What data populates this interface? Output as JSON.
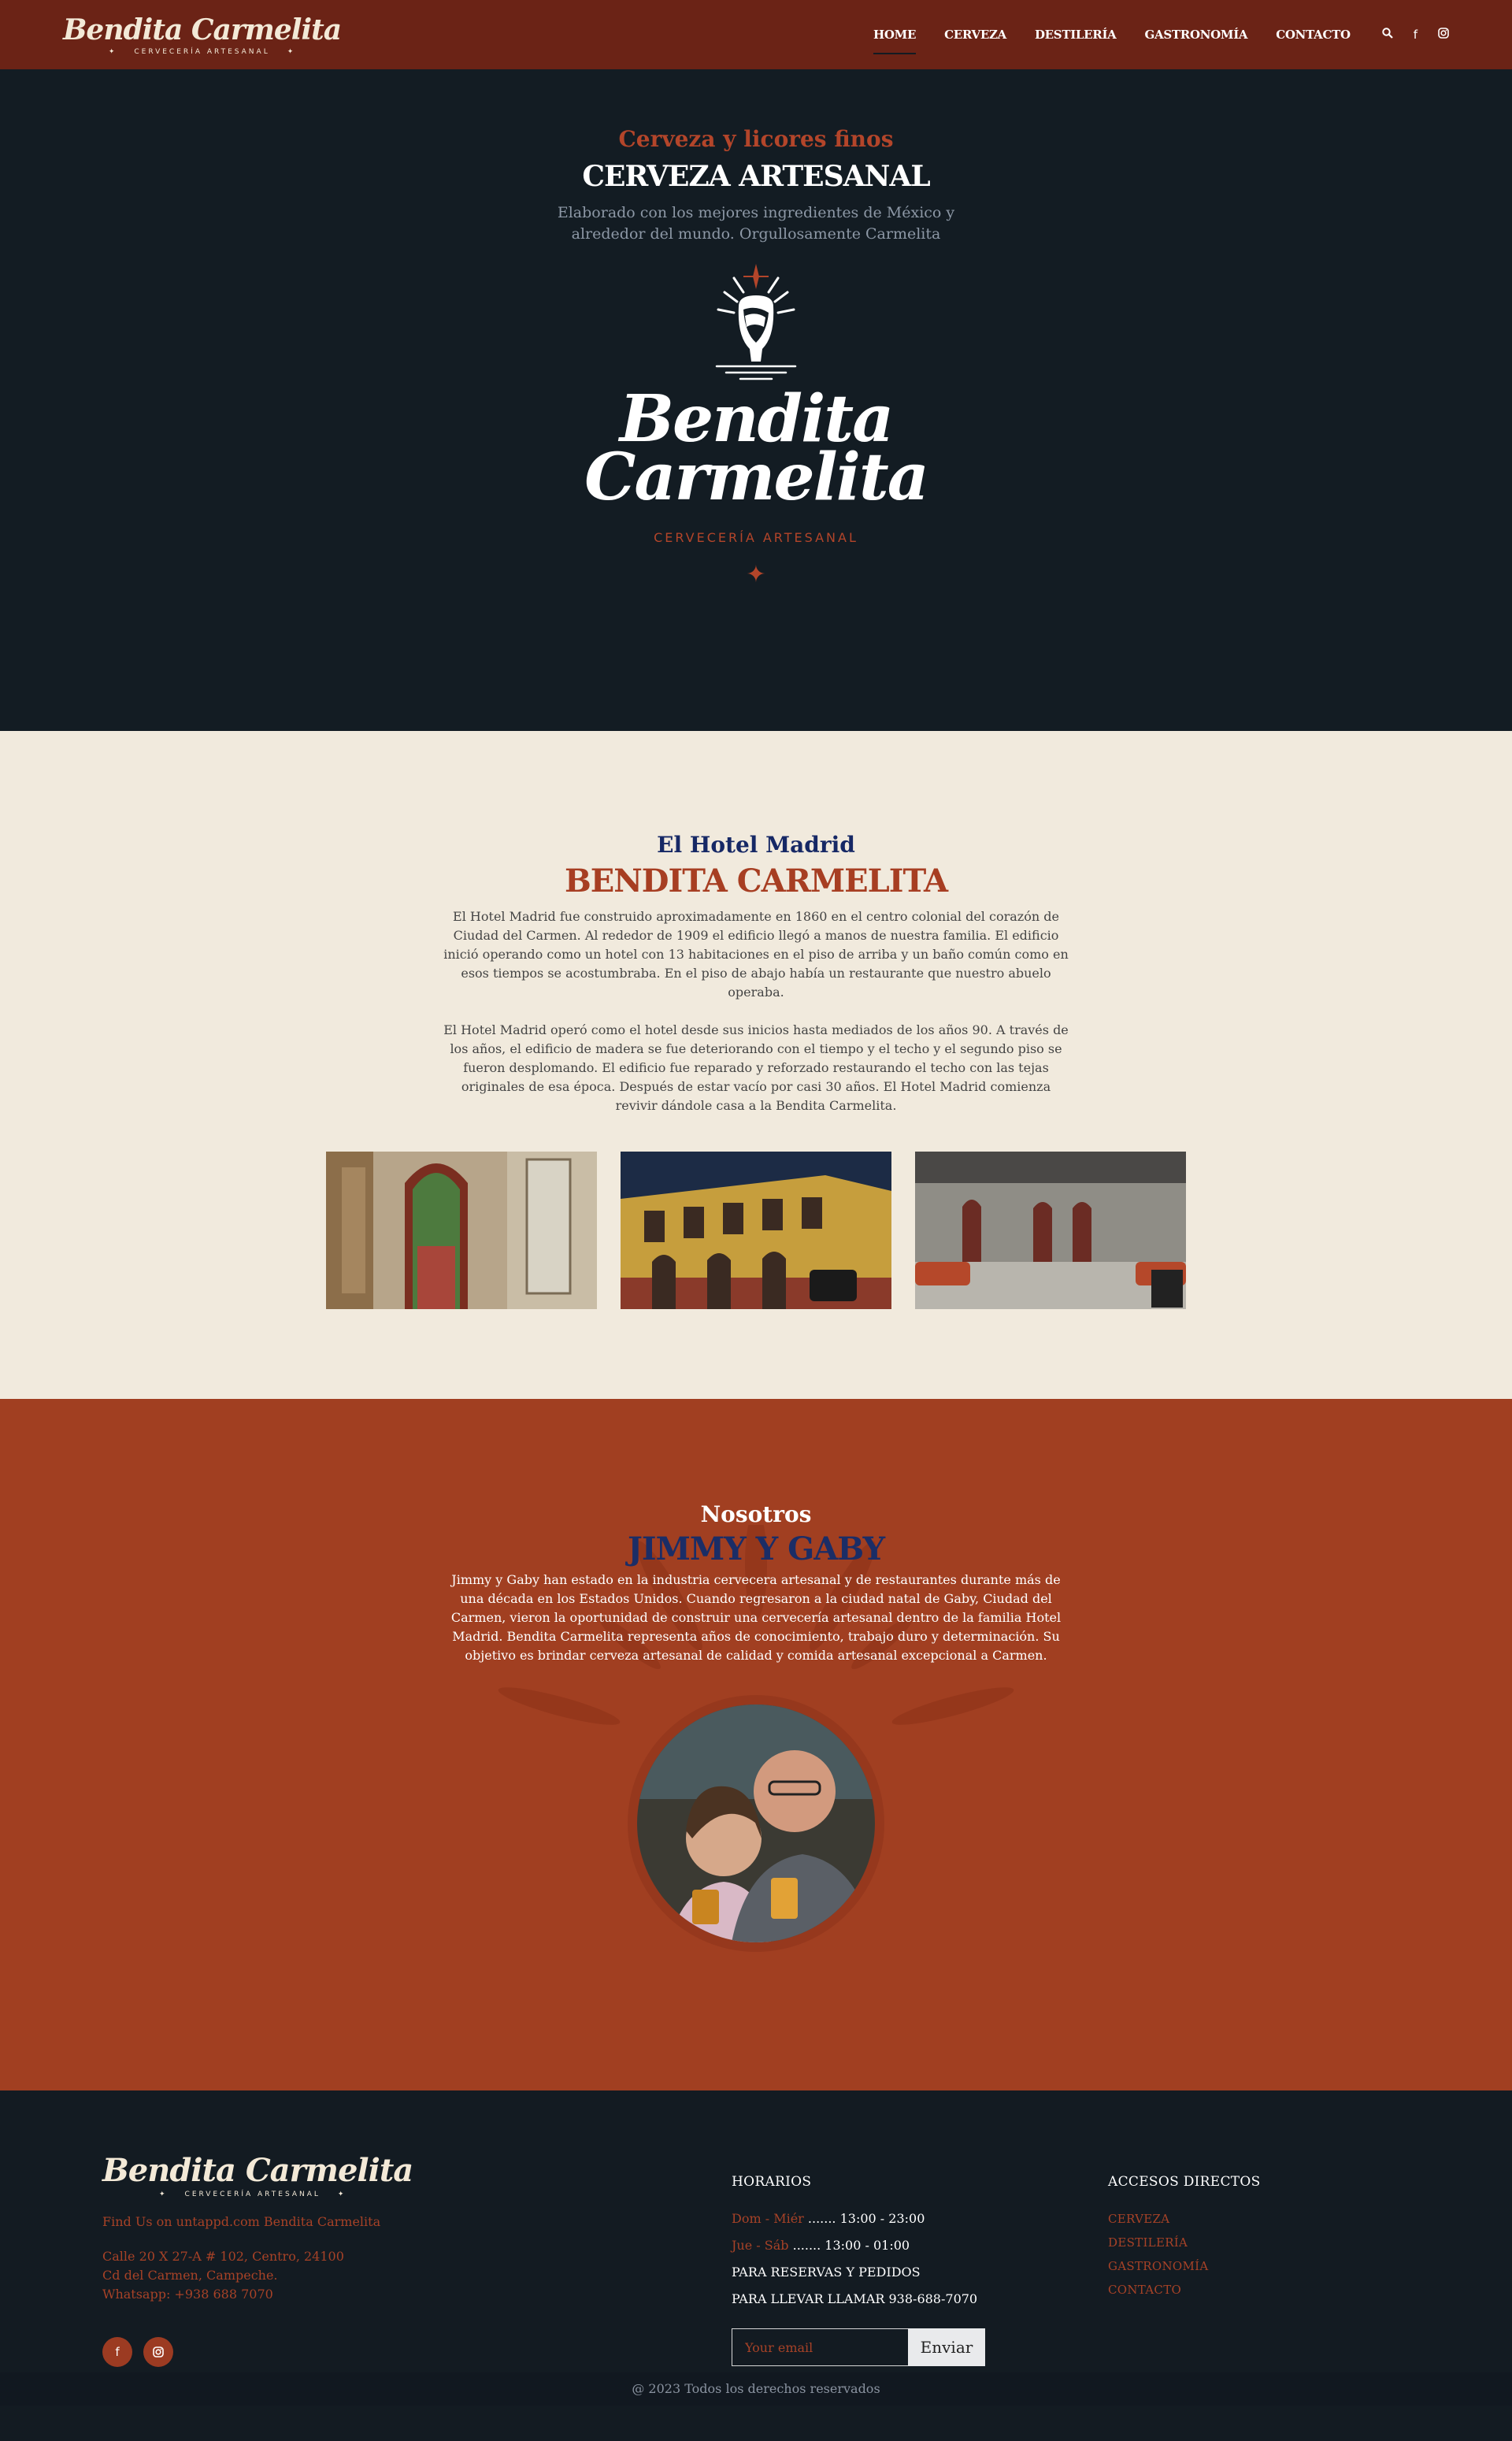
{
  "nav": {
    "logo_name": "Bendita Carmelita",
    "logo_sub": "CERVECERÍA ARTESANAL",
    "items": [
      {
        "label": "HOME"
      },
      {
        "label": "CERVEZA"
      },
      {
        "label": "DESTILERÍA"
      },
      {
        "label": "GASTRONOMÍA"
      },
      {
        "label": "CONTACTO"
      }
    ]
  },
  "hero": {
    "kicker": "Cerveza y licores finos",
    "title": "CERVEZA ARTESANAL",
    "description": "Elaborado con los mejores ingredientes de México y alrededor del mundo. Orgullosamente Carmelita",
    "brand_line1": "Bendita",
    "brand_line2": "Carmelita",
    "brewery": "CERVECERÍA ARTESANAL"
  },
  "hotel": {
    "kicker": "El Hotel Madrid",
    "title": "BENDITA CARMELITA",
    "p1": "El Hotel Madrid fue construido aproximadamente en 1860 en el centro colonial del corazón de Ciudad del Carmen. Al rededor de 1909 el edificio llegó a manos de nuestra familia. El edificio inició operando como un hotel con 13 habitaciones en el piso de arriba y un baño común como en esos tiempos se acostumbraba. En el piso de abajo había un restaurante que nuestro abuelo operaba.",
    "p2": "El Hotel Madrid operó como el hotel desde sus inicios hasta mediados de los años 90. A través de los años, el edificio de madera se fue deteriorando con el tiempo y el techo y el segundo piso se fueron desplomando. El edificio fue reparado y reforzado restaurando el techo con las tejas originales de esa época. Después de estar vacío por casi 30 años. El Hotel Madrid comienza revivir dándole casa a la Bendita Carmelita."
  },
  "about": {
    "kicker": "Nosotros",
    "title": "JIMMY Y GABY",
    "text": "Jimmy y Gaby han estado en la industria cervecera artesanal y de restaurantes durante más de una década en los Estados Unidos. Cuando regresaron a la ciudad natal de Gaby, Ciudad del Carmen, vieron la oportunidad de construir una cervecería artesanal dentro de la familia Hotel Madrid. Bendita Carmelita representa años de conocimiento, trabajo duro y determinación. Su objetivo es brindar cerveza artesanal de calidad y comida artesanal excepcional a Carmen."
  },
  "footer": {
    "logo_name": "Bendita Carmelita",
    "logo_sub": "CERVECERÍA ARTESANAL",
    "untappd": "Find Us on untappd.com Bendita Carmelita",
    "address1": "Calle 20 X 27-A # 102, Centro, 24100",
    "address2": "Cd del Carmen, Campeche.",
    "whatsapp": "Whatsapp: +938 688 7070",
    "hours_title": "HORARIOS",
    "hours": [
      {
        "days": "Dom - Miér",
        "dots": " ....... ",
        "time": "13:00 - 23:00"
      },
      {
        "days": "Jue - Sáb",
        "dots": " ....... ",
        "time": "13:00 - 01:00"
      }
    ],
    "reservas": "PARA RESERVAS Y PEDIDOS",
    "llevar": "PARA LLEVAR LLAMAR 938-688-7070",
    "email_placeholder": "Your email",
    "send_label": "Enviar",
    "links_title": "ACCESOS DIRECTOS",
    "links": [
      {
        "label": "CERVEZA"
      },
      {
        "label": "DESTILERÍA"
      },
      {
        "label": "GASTRONOMÍA"
      },
      {
        "label": "CONTACTO"
      }
    ],
    "copyright": "@ 2023 Todos los derechos reservados"
  },
  "icons": {
    "search": "search-icon",
    "facebook": "facebook-icon",
    "instagram": "instagram-icon"
  },
  "colors": {
    "nav_bg": "#6b2316",
    "hero_bg": "#131c23",
    "accent": "#b3452a",
    "cream": "#f1eadd",
    "about_bg": "#a13f21",
    "navy": "#162865"
  }
}
